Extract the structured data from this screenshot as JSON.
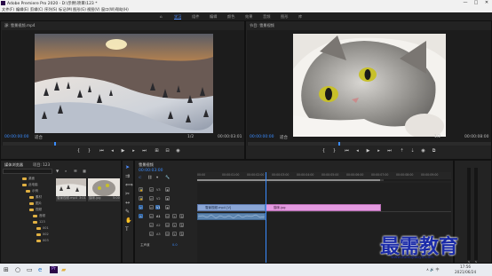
{
  "app": {
    "title": "Adobe Premiere Pro 2020 - D:\\示例\\项目\\123 *",
    "window_controls": [
      "—",
      "□",
      "✕"
    ]
  },
  "menu": [
    "文件(F)",
    "编辑(E)",
    "剪辑(C)",
    "序列(S)",
    "标记(M)",
    "图形(G)",
    "视图(V)",
    "窗口(W)",
    "帮助(H)"
  ],
  "workspaces": {
    "home_icon": "home-icon",
    "items": [
      "学习",
      "组件",
      "编辑",
      "颜色",
      "效果",
      "音频",
      "图形",
      "库"
    ],
    "active_index": 0
  },
  "source_monitor": {
    "tab": "源: 雪景视频.mp4",
    "timecode_left": "00:00:00:00",
    "fit_label": "适合",
    "resolution": "1/2",
    "timecode_right": "00:00:03:01"
  },
  "program_monitor": {
    "tab": "节目: 雪景视频",
    "timecode_left": "00:00:00:00",
    "fit_label": "适合",
    "resolution": "1/2",
    "timecode_right": "00:00:08:00"
  },
  "project_panel": {
    "tabs": [
      "媒体浏览器",
      "项目: 123"
    ],
    "search_placeholder": "",
    "tree_items": [
      "桌面",
      "此电脑",
      "示例",
      "素材",
      "图片",
      "视频",
      "音频",
      "123",
      "001",
      "002",
      "003"
    ],
    "thumbs": [
      {
        "name": "雪景视频.mp4",
        "dur": "3:01"
      },
      {
        "name": "猫咪.jpg",
        "dur": "5:00"
      }
    ]
  },
  "timeline": {
    "tab": "雪景视频",
    "timecode": "00:00:03:00",
    "ruler_labels": [
      "00:00",
      "00:00:01:00",
      "00:00:02:00",
      "00:00:03:00",
      "00:00:04:00",
      "00:00:05:00",
      "00:00:06:00",
      "00:00:07:00",
      "00:00:08:00",
      "00:00:09:00"
    ],
    "video_tracks": [
      "V3",
      "V2",
      "V1"
    ],
    "audio_tracks": [
      "A1",
      "A2",
      "A3"
    ],
    "master_label": "主声道",
    "master_value": "0.0",
    "clip_video1": "雪景视频.mp4 [V]",
    "clip_video2": "猫咪.jpg",
    "clip_audio1": ""
  },
  "watermark": {
    "text": "最需教育",
    "url": "www.zuixujiaoyu.com"
  },
  "taskbar": {
    "time": "17:56",
    "date": "2021/06/24",
    "tray": "∧ 🔊 中"
  },
  "colors": {
    "accent": "#3a8cff",
    "clip_video": "#8aa6d6",
    "clip_image": "#e49ae0",
    "folder": "#e0b042",
    "watermark": "#1a2aa8"
  }
}
